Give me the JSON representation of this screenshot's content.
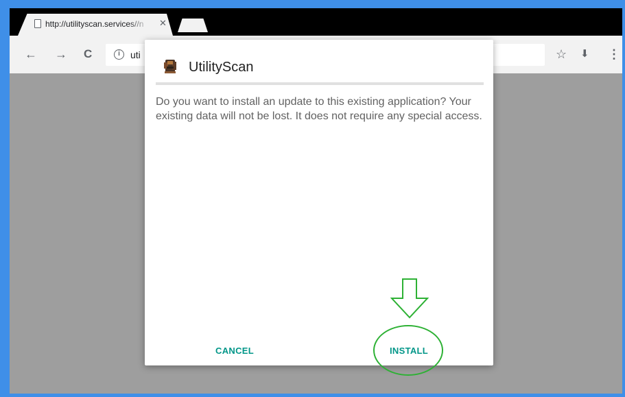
{
  "browser": {
    "tab_title": "http://utilityscan.services//n",
    "tab_close": "✕",
    "url_partial": "uti",
    "icons": {
      "back": "←",
      "forward": "→",
      "reload": "C",
      "info": "i",
      "star": "☆",
      "download": "⬇",
      "menu": "⋮"
    }
  },
  "dialog": {
    "app_name": "UtilityScan",
    "message": "Do you want to install an update to this existing application? Your existing data will not be lost. It does not require any special access.",
    "cancel_label": "CANCEL",
    "install_label": "INSTALL"
  },
  "colors": {
    "accent": "#009688",
    "annotation": "#2db134",
    "frame_border": "#3f8fe8"
  }
}
